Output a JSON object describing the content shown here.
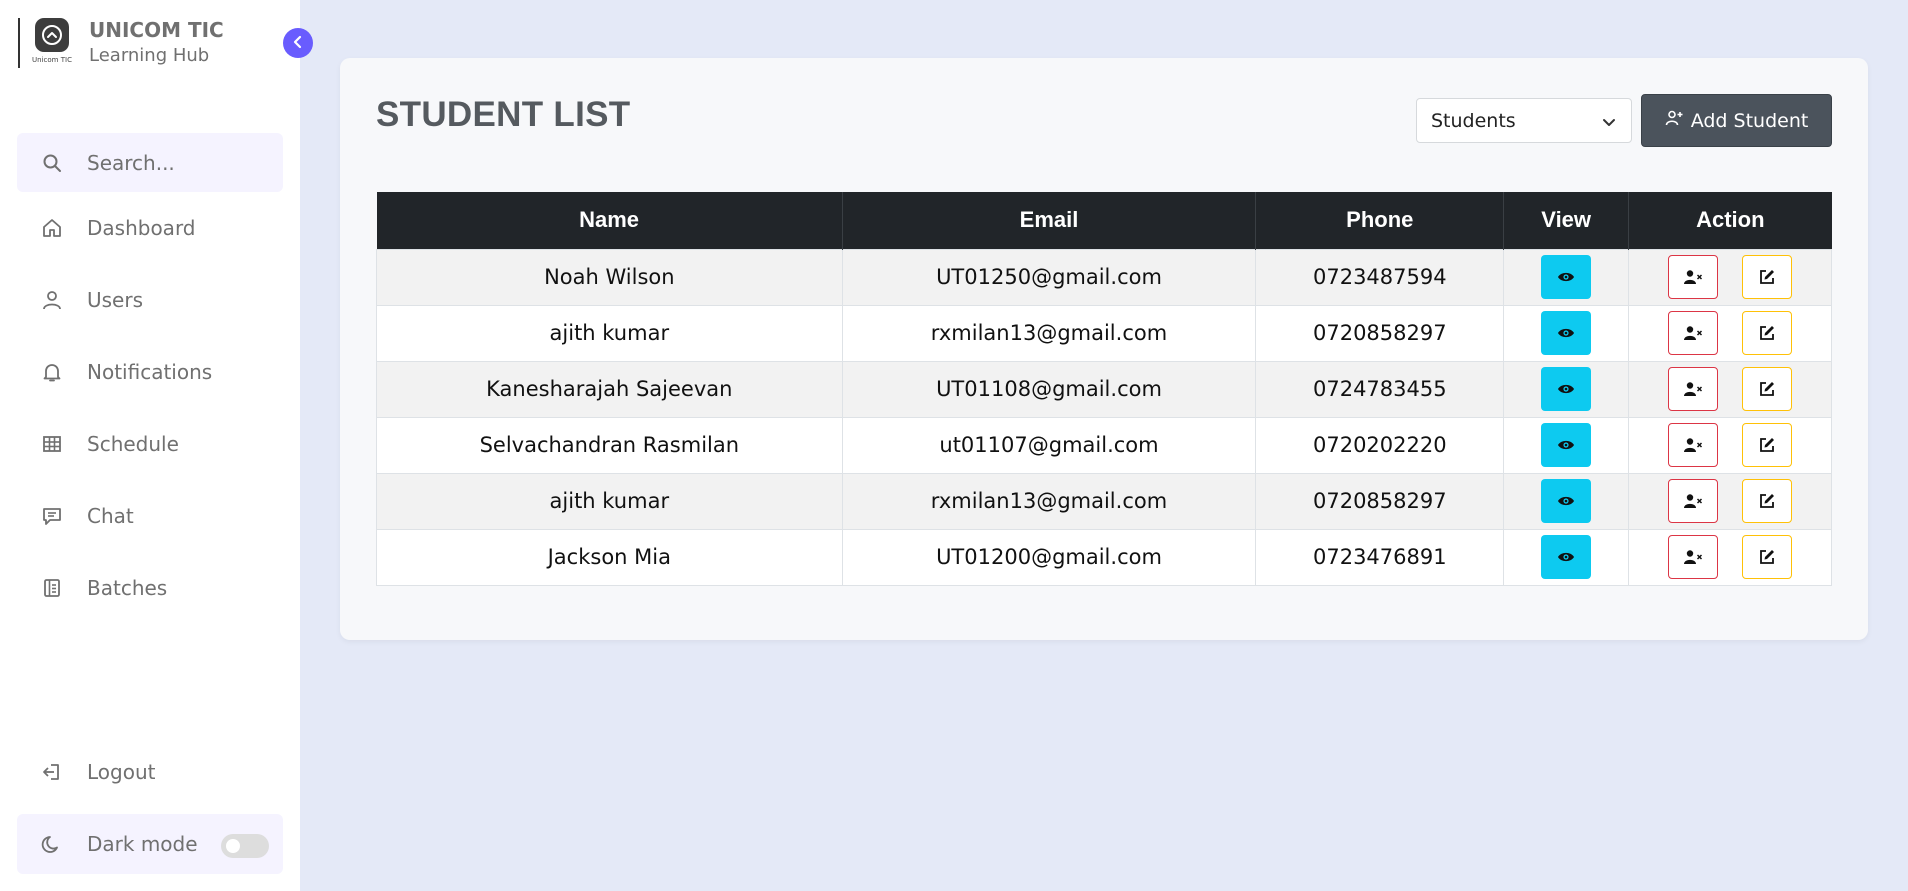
{
  "brand": {
    "title": "UNICOM TIC",
    "subtitle": "Learning Hub",
    "logo_caption": "Unicom TIC"
  },
  "search": {
    "placeholder": "Search..."
  },
  "nav": [
    {
      "label": "Dashboard",
      "icon": "home-icon"
    },
    {
      "label": "Users",
      "icon": "user-icon"
    },
    {
      "label": "Notifications",
      "icon": "bell-icon"
    },
    {
      "label": "Schedule",
      "icon": "table-icon"
    },
    {
      "label": "Chat",
      "icon": "chat-icon"
    },
    {
      "label": "Batches",
      "icon": "batch-icon"
    }
  ],
  "logout": {
    "label": "Logout"
  },
  "dark_mode": {
    "label": "Dark mode",
    "enabled": false
  },
  "main": {
    "title": "STUDENT LIST",
    "select_value": "Students",
    "add_button": "Add Student",
    "columns": [
      "Name",
      "Email",
      "Phone",
      "View",
      "Action"
    ],
    "rows": [
      {
        "name": "Noah Wilson",
        "email": "UT01250@gmail.com",
        "phone": "0723487594"
      },
      {
        "name": "ajith kumar",
        "email": "rxmilan13@gmail.com",
        "phone": "0720858297"
      },
      {
        "name": "Kanesharajah Sajeevan",
        "email": "UT01108@gmail.com",
        "phone": "0724783455"
      },
      {
        "name": "Selvachandran Rasmilan",
        "email": "ut01107@gmail.com",
        "phone": "0720202220"
      },
      {
        "name": "ajith kumar",
        "email": "rxmilan13@gmail.com",
        "phone": "0720858297"
      },
      {
        "name": "Jackson Mia",
        "email": "UT01200@gmail.com",
        "phone": "0723476891"
      }
    ]
  },
  "colors": {
    "accent": "#695cfe",
    "page_bg": "#e4e9f7",
    "header_bg": "#212529",
    "view_btn": "#0dcaf0",
    "delete_border": "#dc3545",
    "edit_border": "#ffc107",
    "add_btn": "#4b535c"
  }
}
